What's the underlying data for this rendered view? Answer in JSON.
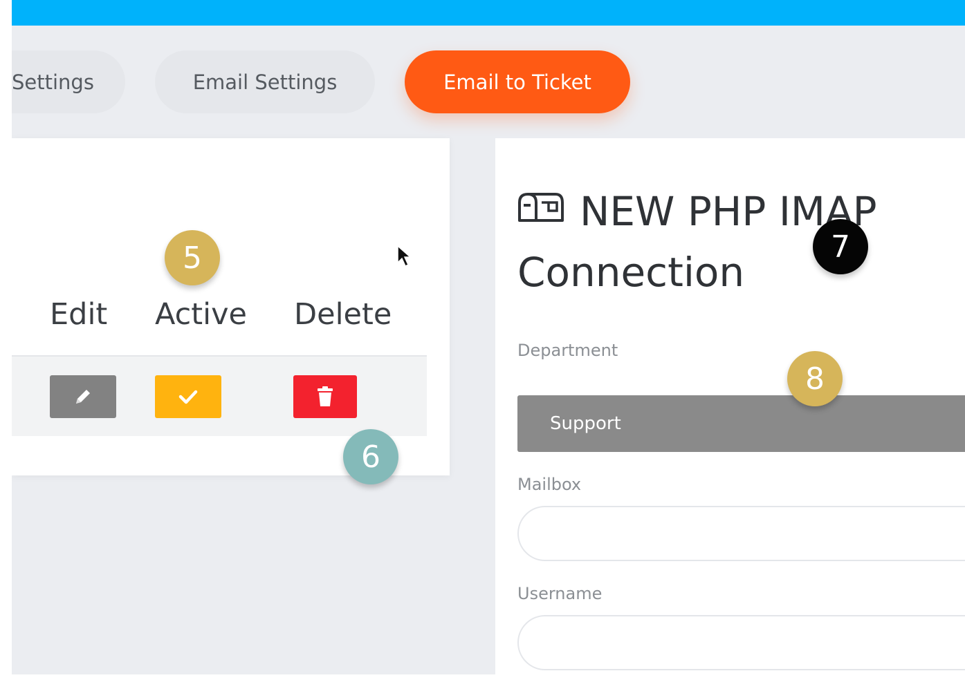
{
  "tabs": {
    "prev_label": "Settings",
    "email_settings_label": "Email Settings",
    "email_to_ticket_label": "Email to Ticket"
  },
  "table": {
    "headers": {
      "edit": "Edit",
      "active": "Active",
      "delete": "Delete"
    }
  },
  "badges": {
    "b5": "5",
    "b6": "6",
    "b7": "7",
    "b8": "8"
  },
  "form": {
    "title": "NEW PHP IMAP Connection",
    "department_label": "Department",
    "department_value": "Support",
    "mailbox_label": "Mailbox",
    "mailbox_value": "",
    "username_label": "Username",
    "username_value": ""
  },
  "colors": {
    "topbar": "#00b2fb",
    "accent": "#ff5a14",
    "edit": "#828282",
    "active": "#ffb30f",
    "delete": "#f3222e"
  },
  "icons": [
    "pencil-icon",
    "check-icon",
    "trash-icon",
    "mailbox-icon",
    "cursor-icon"
  ]
}
